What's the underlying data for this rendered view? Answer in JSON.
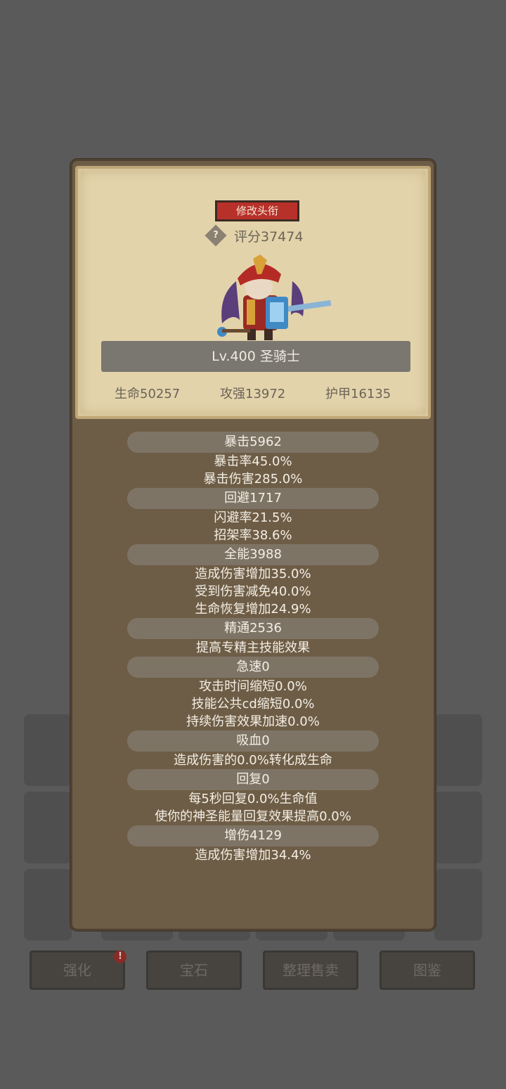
{
  "background": {
    "buttons": [
      {
        "label": "强化",
        "badge": "!"
      },
      {
        "label": "宝石"
      },
      {
        "label": "整理售卖"
      },
      {
        "label": "图鉴"
      }
    ]
  },
  "panel": {
    "rename_button": "修改头衔",
    "help_icon": "?",
    "score_label": "评分37474",
    "name_bar": "Lv.400 圣骑士",
    "stats": {
      "hp": "生命50257",
      "attack": "攻强13972",
      "armor": "护甲16135"
    },
    "attributes": [
      {
        "header": "暴击5962",
        "lines": [
          "暴击率45.0%",
          "暴击伤害285.0%"
        ]
      },
      {
        "header": "回避1717",
        "lines": [
          "闪避率21.5%",
          "招架率38.6%"
        ]
      },
      {
        "header": "全能3988",
        "lines": [
          "造成伤害增加35.0%",
          "受到伤害减免40.0%",
          "生命恢复增加24.9%"
        ]
      },
      {
        "header": "精通2536",
        "lines": [
          "提高专精主技能效果"
        ]
      },
      {
        "header": "急速0",
        "lines": [
          "攻击时间缩短0.0%",
          "技能公共cd缩短0.0%",
          "持续伤害效果加速0.0%"
        ]
      },
      {
        "header": "吸血0",
        "lines": [
          "造成伤害的0.0%转化成生命"
        ]
      },
      {
        "header": "回复0",
        "lines": [
          "每5秒回复0.0%生命值",
          "使你的神圣能量回复效果提高0.0%"
        ]
      },
      {
        "header": "增伤4129",
        "lines": [
          "造成伤害增加34.4%"
        ]
      }
    ]
  },
  "colors": {
    "page_bg": "#5a5a5a",
    "panel_bg": "#6e5d46",
    "parchment": "#e3d3ab",
    "rename_button": "#b8302a"
  }
}
